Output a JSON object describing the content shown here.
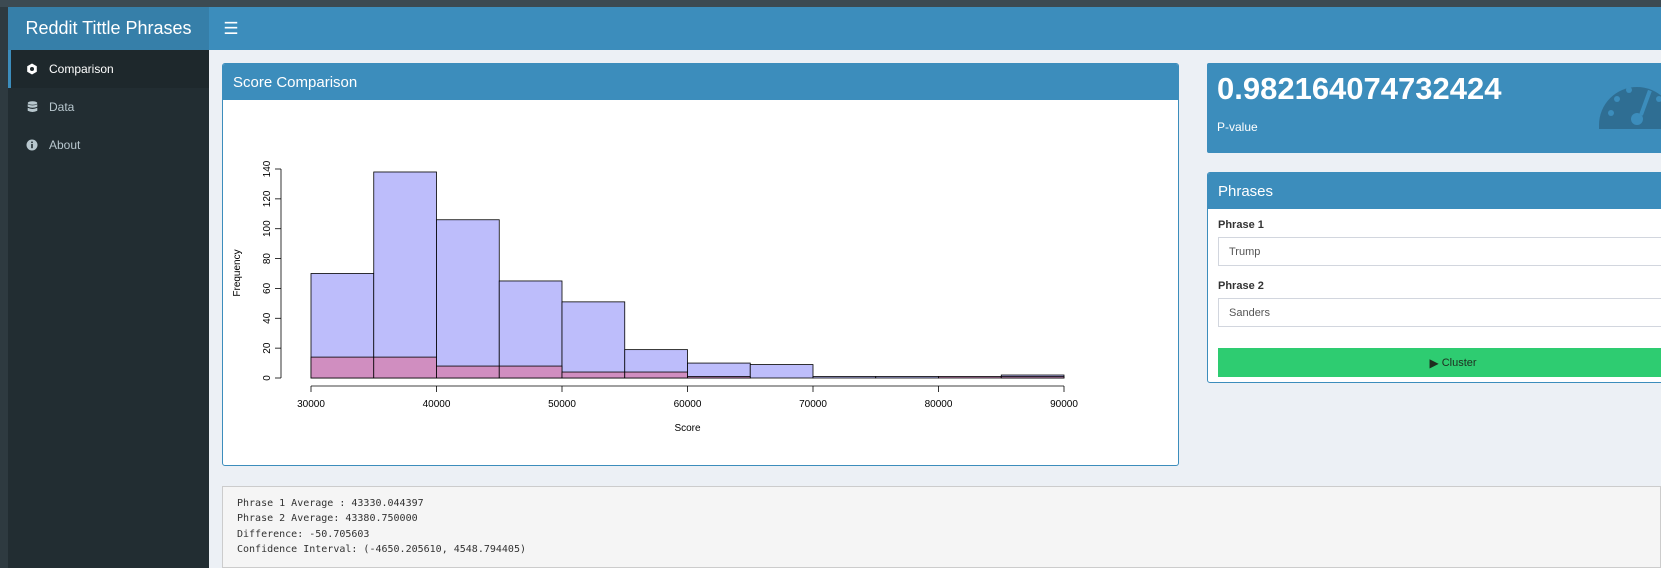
{
  "app": {
    "title": "Reddit Tittle Phrases"
  },
  "header": {
    "menu_icon": "hamburger-icon"
  },
  "sidebar": {
    "items": [
      {
        "label": "Comparison",
        "icon": "dashboard-icon",
        "active": true
      },
      {
        "label": "Data",
        "icon": "database-icon",
        "active": false
      },
      {
        "label": "About",
        "icon": "info-circle-icon",
        "active": false
      }
    ]
  },
  "score_box": {
    "title": "Score Comparison"
  },
  "pvalue_box": {
    "value": "0.982164074732424",
    "label": "P-value",
    "icon": "tachometer-icon"
  },
  "phrases_box": {
    "title": "Phrases",
    "phrase1_label": "Phrase 1",
    "phrase1_value": "Trump",
    "phrase2_label": "Phrase 2",
    "phrase2_value": "Sanders",
    "cluster_label": "Cluster",
    "cluster_icon": "play-icon"
  },
  "summary": {
    "lines": [
      "Phrase 1 Average : 43330.044397",
      "Phrase 2 Average: 43380.750000",
      "Difference: -50.705603",
      "Confidence Interval: (-4650.205610, 4548.794405)"
    ]
  },
  "colors": {
    "primary": "#3c8dbc",
    "sidebar": "#222d32",
    "success": "#2ecc71",
    "series1_fill": "#bdbdfb",
    "series2_fill": "#d08ec0"
  },
  "chart_data": {
    "type": "bar",
    "title": "",
    "xlabel": "Score",
    "ylabel": "Frequency",
    "xlim": [
      30000,
      90000
    ],
    "ylim": [
      0,
      140
    ],
    "x_ticks": [
      "30000",
      "40000",
      "50000",
      "60000",
      "70000",
      "80000",
      "90000"
    ],
    "y_ticks": [
      "0",
      "20",
      "40",
      "60",
      "80",
      "100",
      "120",
      "140"
    ],
    "bin_edges": [
      30000,
      35000,
      40000,
      45000,
      50000,
      55000,
      60000,
      65000,
      70000,
      75000,
      80000,
      85000,
      90000
    ],
    "grid": false,
    "series": [
      {
        "values": [
          70,
          138,
          106,
          65,
          51,
          19,
          10,
          9,
          1,
          1,
          0,
          2
        ],
        "color": "#bdbdfb"
      },
      {
        "values": [
          14,
          14,
          8,
          8,
          4,
          4,
          1,
          0,
          0,
          0,
          1,
          1
        ],
        "color": "#d08ec0"
      }
    ]
  }
}
